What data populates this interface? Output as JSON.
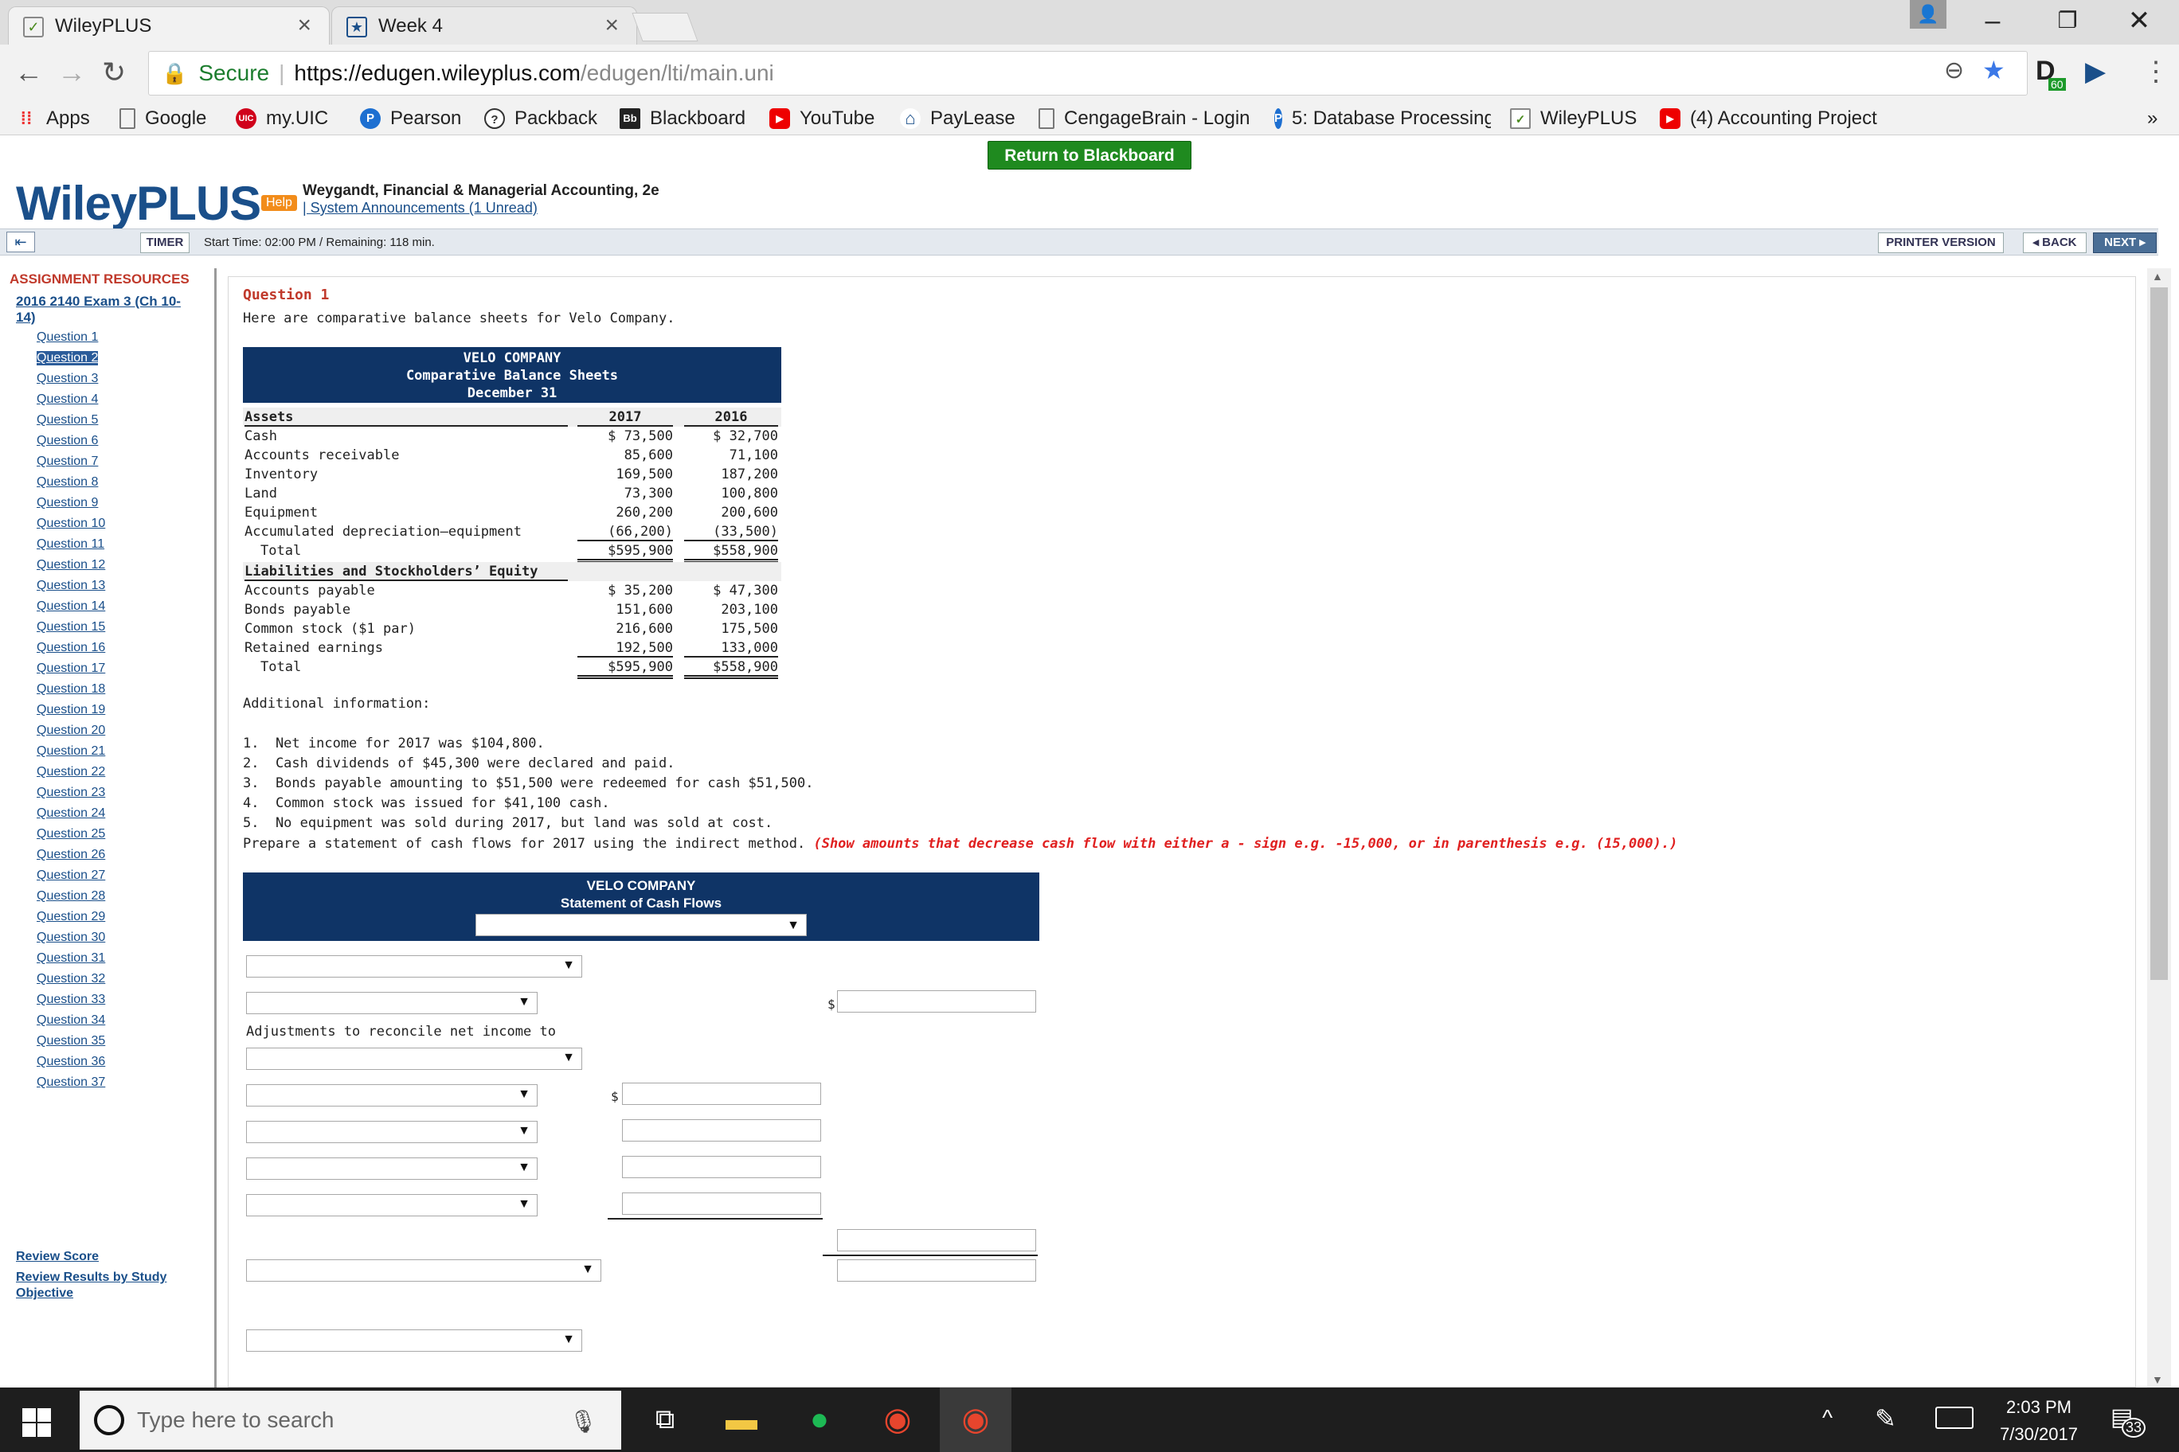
{
  "browser": {
    "tabs": [
      {
        "title": "WileyPLUS"
      },
      {
        "title": "Week 4"
      }
    ],
    "secure_label": "Secure",
    "url_host": "https://edugen.wileyplus.com",
    "url_path": "/edugen/lti/main.uni",
    "extension_badge": "60",
    "bookmarks": [
      {
        "label": "Apps",
        "icon": "apps-grid-icon"
      },
      {
        "label": "Google",
        "icon": "page-icon"
      },
      {
        "label": "my.UIC",
        "icon": "uic-icon",
        "badge": "UIC"
      },
      {
        "label": "Pearson",
        "icon": "pearson-icon",
        "badge": "P"
      },
      {
        "label": "Packback",
        "icon": "packback-icon",
        "badge": "?"
      },
      {
        "label": "Blackboard",
        "icon": "blackboard-icon",
        "badge": "Bb"
      },
      {
        "label": "YouTube",
        "icon": "youtube-icon",
        "badge": "▶"
      },
      {
        "label": "PayLease",
        "icon": "paylease-icon",
        "badge": "⌂"
      },
      {
        "label": "CengageBrain - Login",
        "icon": "page-icon"
      },
      {
        "label": "5: Database Processing",
        "icon": "pearson-icon",
        "badge": "P"
      },
      {
        "label": "WileyPLUS",
        "icon": "wileyplus-icon",
        "badge": "✓"
      },
      {
        "label": "(4) Accounting Project",
        "icon": "youtube-icon",
        "badge": "▶"
      }
    ],
    "more_bookmarks": "»"
  },
  "header": {
    "return_button": "Return to Blackboard",
    "logo": "WileyPLUS",
    "help_badge": "Help",
    "course": "Weygandt, Financial & Managerial Accounting, 2e",
    "announcements": "| System Announcements (1 Unread)"
  },
  "toolbar": {
    "timer_button": "TIMER",
    "timer_text": "Start Time: 02:00 PM / Remaining: 118 min.",
    "printer_button": "PRINTER VERSION",
    "back_button": "◂ BACK",
    "next_button": "NEXT ▸"
  },
  "sidebar": {
    "title": "ASSIGNMENT RESOURCES",
    "assignment": "2016 2140 Exam 3 (Ch 10-14)",
    "questions": [
      "Question 1",
      "Question 2",
      "Question 3",
      "Question 4",
      "Question 5",
      "Question 6",
      "Question 7",
      "Question 8",
      "Question 9",
      "Question 10",
      "Question 11",
      "Question 12",
      "Question 13",
      "Question 14",
      "Question 15",
      "Question 16",
      "Question 17",
      "Question 18",
      "Question 19",
      "Question 20",
      "Question 21",
      "Question 22",
      "Question 23",
      "Question 24",
      "Question 25",
      "Question 26",
      "Question 27",
      "Question 28",
      "Question 29",
      "Question 30",
      "Question 31",
      "Question 32",
      "Question 33",
      "Question 34",
      "Question 35",
      "Question 36",
      "Question 37"
    ],
    "active_question": "Question 2",
    "review_score": "Review Score",
    "review_results": "Review Results by Study Objective"
  },
  "question": {
    "title": "Question 1",
    "intro": "Here are comparative balance sheets for Velo Company.",
    "balance_sheet": {
      "company": "VELO COMPANY",
      "statement": "Comparative Balance Sheets",
      "date": "December 31",
      "assets_header": "Assets",
      "year1": "2017",
      "year2": "2016",
      "assets": [
        {
          "label": "Cash",
          "y1": "$ 73,500",
          "y2": "$ 32,700"
        },
        {
          "label": "Accounts receivable",
          "y1": "85,600",
          "y2": "71,100"
        },
        {
          "label": "Inventory",
          "y1": "169,500",
          "y2": "187,200"
        },
        {
          "label": "Land",
          "y1": "73,300",
          "y2": "100,800"
        },
        {
          "label": "Equipment",
          "y1": "260,200",
          "y2": "200,600"
        },
        {
          "label": "Accumulated depreciation—equipment",
          "y1": "(66,200)",
          "y2": "(33,500)"
        }
      ],
      "assets_total": {
        "label": "Total",
        "y1": "$595,900",
        "y2": "$558,900"
      },
      "liab_header": "Liabilities and Stockholders’ Equity",
      "liabilities": [
        {
          "label": "Accounts payable",
          "y1": "$ 35,200",
          "y2": "$ 47,300"
        },
        {
          "label": "Bonds payable",
          "y1": "151,600",
          "y2": "203,100"
        },
        {
          "label": "Common stock ($1 par)",
          "y1": "216,600",
          "y2": "175,500"
        },
        {
          "label": "Retained earnings",
          "y1": "192,500",
          "y2": "133,000"
        }
      ],
      "liab_total": {
        "label": "Total",
        "y1": "$595,900",
        "y2": "$558,900"
      }
    },
    "additional_header": "Additional information:",
    "notes": [
      "1.  Net income for 2017 was $104,800.",
      "2.  Cash dividends of $45,300 were declared and paid.",
      "3.  Bonds payable amounting to $51,500 were redeemed for cash $51,500.",
      "4.  Common stock was issued for $41,100 cash.",
      "5.  No equipment was sold during 2017, but land was sold at cost."
    ],
    "prepare": "Prepare a statement of cash flows for 2017 using the indirect method.",
    "prepare_warning": "(Show amounts that decrease cash flow with either a - sign e.g. -15,000, or in parenthesis e.g. (15,000).)",
    "cash_flow": {
      "company": "VELO COMPANY",
      "statement": "Statement of Cash Flows",
      "adjustments_label": "Adjustments to reconcile net income to",
      "dollar": "$",
      "dropdown_arrow": "▼"
    }
  },
  "taskbar": {
    "search_placeholder": "Type here to search",
    "time": "2:03 PM",
    "date": "7/30/2017",
    "notifications": "33"
  }
}
